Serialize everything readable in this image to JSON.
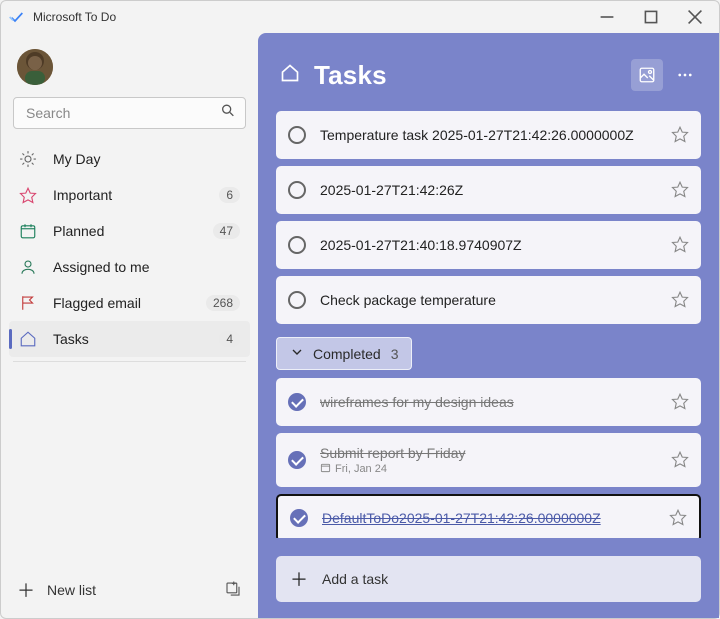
{
  "app": {
    "title": "Microsoft To Do"
  },
  "search": {
    "placeholder": "Search"
  },
  "sidebar": {
    "items": [
      {
        "icon": "sun",
        "label": "My Day",
        "badge": ""
      },
      {
        "icon": "star",
        "label": "Important",
        "badge": "6"
      },
      {
        "icon": "calendar",
        "label": "Planned",
        "badge": "47"
      },
      {
        "icon": "person",
        "label": "Assigned to me",
        "badge": ""
      },
      {
        "icon": "flag",
        "label": "Flagged email",
        "badge": "268"
      },
      {
        "icon": "home",
        "label": "Tasks",
        "badge": "4"
      }
    ]
  },
  "newlist": {
    "label": "New list"
  },
  "main": {
    "title": "Tasks",
    "tasks": [
      {
        "title": "Temperature task 2025-01-27T21:42:26.0000000Z"
      },
      {
        "title": "2025-01-27T21:42:26Z"
      },
      {
        "title": "2025-01-27T21:40:18.9740907Z"
      },
      {
        "title": "Check package temperature"
      }
    ],
    "completed_label": "Completed",
    "completed_count": "3",
    "completed_tasks": [
      {
        "title": "wireframes for my design ideas",
        "due": ""
      },
      {
        "title": "Submit report by Friday",
        "due": "Fri, Jan 24"
      },
      {
        "title": "DefaultToDo2025-01-27T21:42:26.0000000Z",
        "due": "",
        "link": true
      }
    ],
    "add_task_label": "Add a task"
  }
}
